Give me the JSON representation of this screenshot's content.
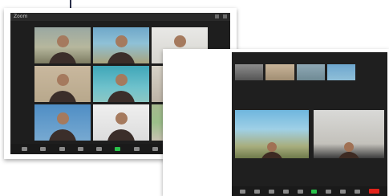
{
  "window1": {
    "title": "Zoom",
    "tiles": [
      {
        "scene": "t-room",
        "participant": ""
      },
      {
        "scene": "t-ocean",
        "participant": ""
      },
      {
        "scene": "t-white",
        "participant": ""
      },
      {
        "scene": "t-beige",
        "participant": ""
      },
      {
        "scene": "t-cyan",
        "participant": ""
      },
      {
        "scene": "t-shelf",
        "participant": ""
      },
      {
        "scene": "t-blue",
        "participant": ""
      },
      {
        "scene": "t-plain",
        "participant": ""
      },
      {
        "scene": "t-green",
        "participant": ""
      }
    ],
    "toolbar_icons": [
      "mute-icon",
      "video-icon",
      "security-icon",
      "participants-icon",
      "chat-icon",
      "share-screen-icon",
      "record-icon",
      "reactions-icon",
      "apps-icon",
      "more-icon",
      "end-meeting-button"
    ]
  },
  "window2": {
    "strip_tiles": [
      {
        "participant": ""
      },
      {
        "participant": ""
      },
      {
        "participant": ""
      },
      {
        "participant": ""
      }
    ],
    "speakers": [
      {
        "participant": ""
      },
      {
        "participant": ""
      }
    ],
    "toolbar_icons": [
      "mute-icon",
      "video-icon",
      "security-icon",
      "participants-icon",
      "chat-icon",
      "share-screen-icon",
      "record-icon",
      "reactions-icon",
      "more-icon",
      "end-meeting-button"
    ]
  },
  "colors": {
    "meeting_bg": "#1e1e1e",
    "end_button": "#e2231a",
    "active_icon": "#29c24a"
  }
}
